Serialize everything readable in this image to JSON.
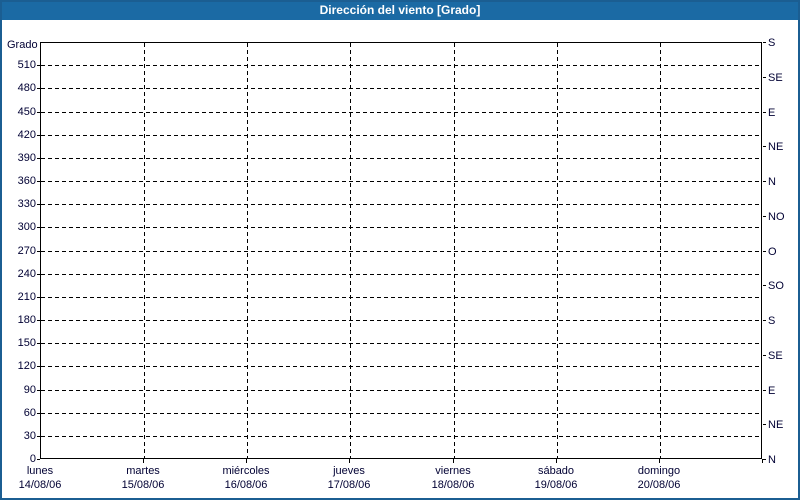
{
  "window": {
    "title": "Dirección del viento [Grado]"
  },
  "colors": {
    "title_bar": "#1b6aa4",
    "window_border": "#1b5e92",
    "plot_border": "#000000",
    "grid": "#000000",
    "axis_text": "#000033",
    "title_text": "#ffffff",
    "background": "#ffffff"
  },
  "chart_data": {
    "type": "line",
    "title": "Dirección del viento [Grado]",
    "ylabel": "Grado",
    "grid": "dashed",
    "legend": "none",
    "series": [],
    "y_axis_left": {
      "label": "Grado",
      "min": 0,
      "max": 540,
      "tick_step": 30,
      "ticks": [
        0,
        30,
        60,
        90,
        120,
        150,
        180,
        210,
        240,
        270,
        300,
        330,
        360,
        390,
        420,
        450,
        480,
        510
      ]
    },
    "y_axis_right": {
      "tick_step_deg": 45,
      "ticks": [
        {
          "deg": 540,
          "label": "S"
        },
        {
          "deg": 495,
          "label": "SE"
        },
        {
          "deg": 450,
          "label": "E"
        },
        {
          "deg": 405,
          "label": "NE"
        },
        {
          "deg": 360,
          "label": "N"
        },
        {
          "deg": 315,
          "label": "NO"
        },
        {
          "deg": 270,
          "label": "O"
        },
        {
          "deg": 225,
          "label": "SO"
        },
        {
          "deg": 180,
          "label": "S"
        },
        {
          "deg": 135,
          "label": "SE"
        },
        {
          "deg": 90,
          "label": "E"
        },
        {
          "deg": 45,
          "label": "NE"
        },
        {
          "deg": 0,
          "label": "N"
        }
      ]
    },
    "x_axis": {
      "days": [
        {
          "name": "lunes",
          "date": "14/08/06"
        },
        {
          "name": "martes",
          "date": "15/08/06"
        },
        {
          "name": "miércoles",
          "date": "16/08/06"
        },
        {
          "name": "jueves",
          "date": "17/08/06"
        },
        {
          "name": "viernes",
          "date": "18/08/06"
        },
        {
          "name": "sábado",
          "date": "19/08/06"
        },
        {
          "name": "domingo",
          "date": "20/08/06"
        }
      ]
    }
  }
}
